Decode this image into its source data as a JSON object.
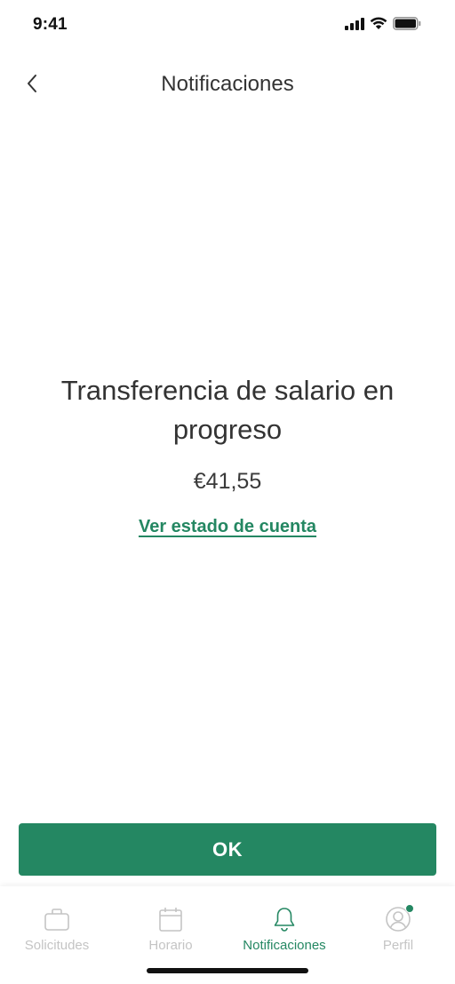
{
  "status_bar": {
    "time": "9:41"
  },
  "header": {
    "title": "Notificaciones"
  },
  "notification": {
    "headline": "Transferencia de salario en progreso",
    "amount": "€41,55",
    "link_label": "Ver estado de cuenta"
  },
  "actions": {
    "ok_label": "OK"
  },
  "tab_bar": {
    "items": [
      {
        "label": "Solicitudes",
        "icon": "briefcase-icon",
        "active": false
      },
      {
        "label": "Horario",
        "icon": "calendar-icon",
        "active": false
      },
      {
        "label": "Notificaciones",
        "icon": "bell-icon",
        "active": true
      },
      {
        "label": "Perfil",
        "icon": "profile-icon",
        "active": false,
        "badge": true
      }
    ]
  },
  "colors": {
    "accent": "#248762",
    "inactive": "#c4c4c4",
    "text": "#333333"
  }
}
